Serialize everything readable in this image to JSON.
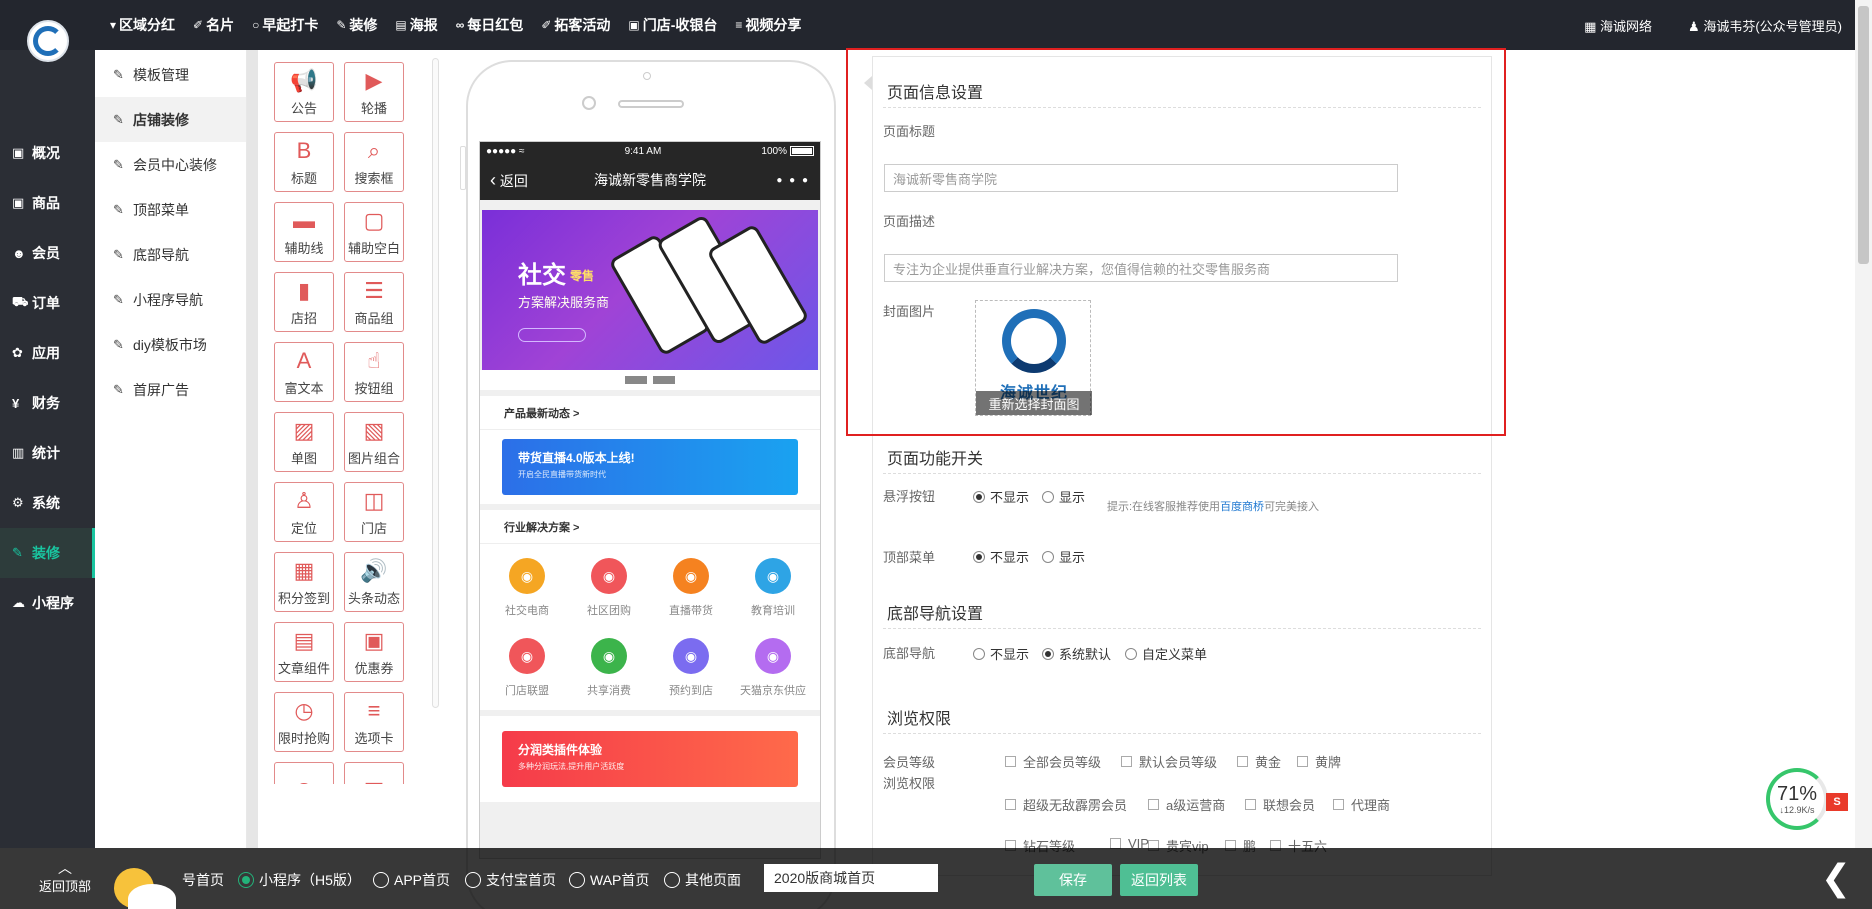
{
  "app": {
    "logo_text": "海诚世纪"
  },
  "topnav": [
    {
      "label": "区域分红",
      "icon": "pin-icon",
      "glyph": "▾"
    },
    {
      "label": "名片",
      "icon": "card-icon",
      "glyph": "✐"
    },
    {
      "label": "早起打卡",
      "icon": "clock-icon",
      "glyph": "○"
    },
    {
      "label": "装修",
      "icon": "brush-icon",
      "glyph": "✎"
    },
    {
      "label": "海报",
      "icon": "poster-icon",
      "glyph": "▤"
    },
    {
      "label": "每日红包",
      "icon": "link-icon",
      "glyph": "∞"
    },
    {
      "label": "拓客活动",
      "icon": "handshake-icon",
      "glyph": "✐"
    },
    {
      "label": "门店-收银台",
      "icon": "cashier-icon",
      "glyph": "▣"
    },
    {
      "label": "视频分享",
      "icon": "list-icon",
      "glyph": "≡"
    }
  ],
  "top_right": {
    "network": "海诚网络",
    "user": "海诚韦芬(公众号管理员)"
  },
  "left_nav": [
    {
      "label": "概况",
      "icon": "overview-icon",
      "glyph": "▣"
    },
    {
      "label": "商品",
      "icon": "goods-icon",
      "glyph": "▣"
    },
    {
      "label": "会员",
      "icon": "members-icon",
      "glyph": "☻"
    },
    {
      "label": "订单",
      "icon": "cart-icon",
      "glyph": "⛟"
    },
    {
      "label": "应用",
      "icon": "apps-icon",
      "glyph": "✿"
    },
    {
      "label": "财务",
      "icon": "yen-icon",
      "glyph": "¥"
    },
    {
      "label": "统计",
      "icon": "chart-icon",
      "glyph": "▥"
    },
    {
      "label": "系统",
      "icon": "gears-icon",
      "glyph": "⚙"
    },
    {
      "label": "装修",
      "icon": "brush-icon",
      "glyph": "✎",
      "active": true
    },
    {
      "label": "小程序",
      "icon": "chat-icon",
      "glyph": "☁"
    }
  ],
  "sub_nav": [
    {
      "label": "模板管理"
    },
    {
      "label": "店铺装修",
      "active": true
    },
    {
      "label": "会员中心装修"
    },
    {
      "label": "顶部菜单"
    },
    {
      "label": "底部导航"
    },
    {
      "label": "小程序导航"
    },
    {
      "label": "diy模板市场"
    },
    {
      "label": "首屏广告"
    }
  ],
  "components": [
    {
      "label": "公告",
      "icon": "megaphone-icon",
      "glyph": "📢"
    },
    {
      "label": "轮播",
      "icon": "video-icon",
      "glyph": "▶"
    },
    {
      "label": "标题",
      "icon": "bold-icon",
      "glyph": "B"
    },
    {
      "label": "搜索框",
      "icon": "search-icon",
      "glyph": "⌕"
    },
    {
      "label": "辅助线",
      "icon": "line-icon",
      "glyph": "▬"
    },
    {
      "label": "辅助空白",
      "icon": "blank-icon",
      "glyph": "▢"
    },
    {
      "label": "店招",
      "icon": "bookmark-icon",
      "glyph": "▮"
    },
    {
      "label": "商品组",
      "icon": "list-icon",
      "glyph": "☰"
    },
    {
      "label": "富文本",
      "icon": "font-icon",
      "glyph": "A"
    },
    {
      "label": "按钮组",
      "icon": "hand-icon",
      "glyph": "☝"
    },
    {
      "label": "单图",
      "icon": "image-icon",
      "glyph": "▨"
    },
    {
      "label": "图片组合",
      "icon": "picture-icon",
      "glyph": "▧"
    },
    {
      "label": "定位",
      "icon": "location-icon",
      "glyph": "♙"
    },
    {
      "label": "门店",
      "icon": "store-icon",
      "glyph": "◫"
    },
    {
      "label": "积分签到",
      "icon": "calendar-icon",
      "glyph": "▦"
    },
    {
      "label": "头条动态",
      "icon": "volume-icon",
      "glyph": "🔊"
    },
    {
      "label": "文章组件",
      "icon": "book-icon",
      "glyph": "▤"
    },
    {
      "label": "优惠券",
      "icon": "coupon-icon",
      "glyph": "▣"
    },
    {
      "label": "限时抢购",
      "icon": "timer-icon",
      "glyph": "◷"
    },
    {
      "label": "选项卡",
      "icon": "tabs-icon",
      "glyph": "≡"
    },
    {
      "label": "",
      "icon": "clock-icon",
      "glyph": "◷"
    },
    {
      "label": "",
      "icon": "doc-icon",
      "glyph": "▤"
    }
  ],
  "phone": {
    "status_left": "●●●●● ≈",
    "status_time": "9:41 AM",
    "status_batt": "100%",
    "back_label": "返回",
    "title": "海诚新零售商学院",
    "more": "● ● ●",
    "banner_line1": "社交",
    "banner_tag": "零售",
    "banner_line2": "方案解决服务商",
    "section1": "产品最新动态 >",
    "promo_title": "带货直播4.0版本上线!",
    "promo_sub": "开启全民直播带货新时代",
    "section2": "行业解决方案 >",
    "icons_row1": [
      {
        "label": "社交电商",
        "icon": "shop-icon",
        "color": "#f5a623"
      },
      {
        "label": "社区团购",
        "icon": "community-icon",
        "color": "#f0565a"
      },
      {
        "label": "直播带货",
        "icon": "live-icon",
        "color": "#f58220"
      },
      {
        "label": "教育培训",
        "icon": "education-icon",
        "color": "#2ea4e5"
      }
    ],
    "icons_row2": [
      {
        "label": "门店联盟",
        "icon": "store-icon",
        "color": "#f0565a"
      },
      {
        "label": "共享消费",
        "icon": "share-icon",
        "color": "#3cb44b"
      },
      {
        "label": "预约到店",
        "icon": "booking-icon",
        "color": "#7b6cf0"
      },
      {
        "label": "天猫京东供应",
        "icon": "supply-icon",
        "color": "#b46cf0"
      }
    ],
    "promo2_title": "分润类插件体验",
    "promo2_sub": "多种分润玩法,提升用户活跃度"
  },
  "panel": {
    "page_info_title": "页面信息设置",
    "page_title_label": "页面标题",
    "page_title_placeholder": "海诚新零售商学院",
    "page_desc_label": "页面描述",
    "page_desc_placeholder": "专注为企业提供垂直行业解决方案，您值得信赖的社交零售服务商",
    "cover_label": "封面图片",
    "cover_brand": "海诚世纪",
    "cover_reselect": "重新选择封面图",
    "func_title": "页面功能开关",
    "float_label": "悬浮按钮",
    "float_opt_hide": "不显示",
    "float_opt_show": "显示",
    "hint_prefix": "提示:在线客服推荐使用",
    "hint_link": "百度商桥",
    "hint_suffix": "可完美接入",
    "topmenu_label": "顶部菜单",
    "topmenu_opt_hide": "不显示",
    "topmenu_opt_show": "显示",
    "bottomnav_title": "底部导航设置",
    "bottomnav_label": "底部导航",
    "bottomnav_opt_hide": "不显示",
    "bottomnav_opt_default": "系统默认",
    "bottomnav_opt_custom": "自定义菜单",
    "perm_title": "浏览权限",
    "perm_label1": "会员等级",
    "perm_label2": "浏览权限",
    "levels_row1": [
      "全部会员等级",
      "默认会员等级",
      "黄金",
      "黄牌"
    ],
    "levels_row2": [
      "超级无敌霹雳会员",
      "a级运营商",
      "联想会员",
      "代理商"
    ],
    "levels_row3": [
      "钻石等级",
      "VIP",
      "贵宾vip",
      "鹏",
      "十五六"
    ]
  },
  "speed": {
    "percent": "71%",
    "rate": "↓12.9K/s"
  },
  "speed_badge": "S",
  "bottom": {
    "back_top": "返回顶部",
    "opt_wechat": "号首页",
    "opt_mini": "小程序（H5版）",
    "opt_app": "APP首页",
    "opt_alipay": "支付宝首页",
    "opt_wap": "WAP首页",
    "opt_other": "其他页面",
    "template_value": "2020版商城首页",
    "save": "保存",
    "back_list": "返回列表",
    "collapse_glyph": "❮"
  }
}
